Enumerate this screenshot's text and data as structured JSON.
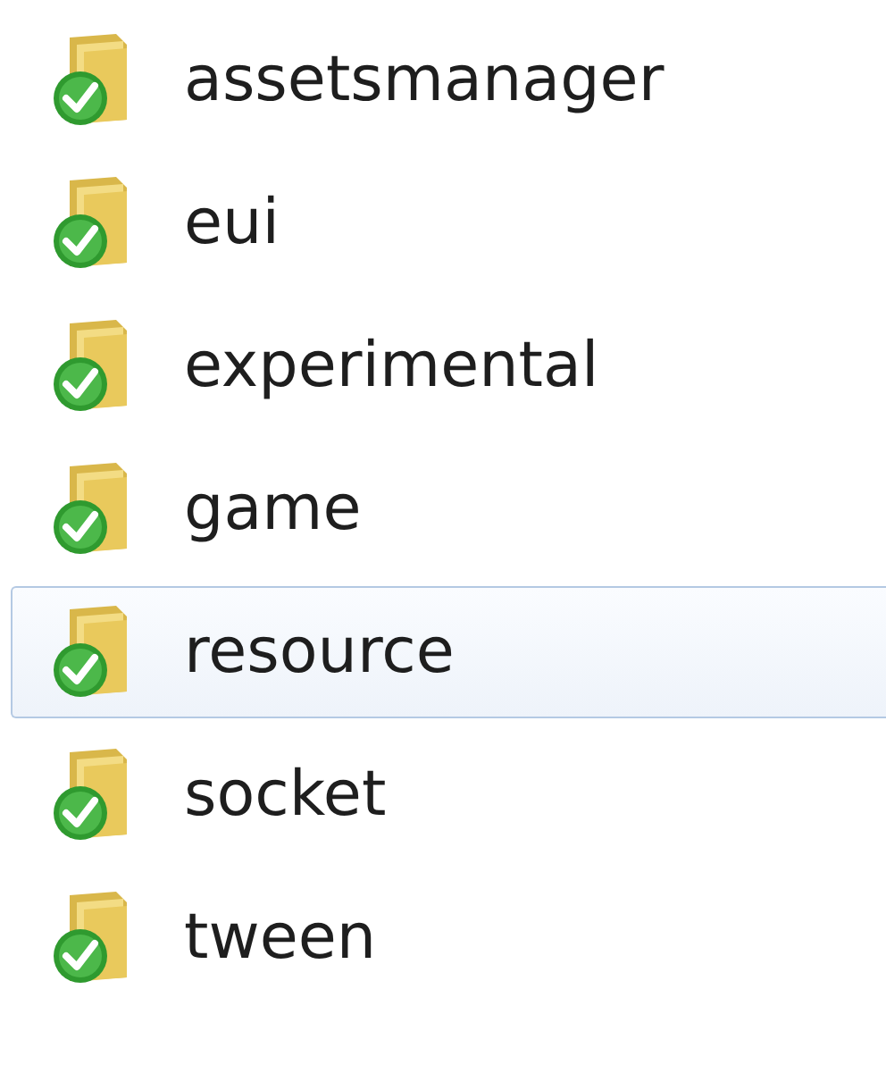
{
  "folders": [
    {
      "name": "assetsmanager",
      "selected": false
    },
    {
      "name": "eui",
      "selected": false
    },
    {
      "name": "experimental",
      "selected": false
    },
    {
      "name": "game",
      "selected": false
    },
    {
      "name": "resource",
      "selected": true
    },
    {
      "name": "socket",
      "selected": false
    },
    {
      "name": "tween",
      "selected": false
    }
  ]
}
